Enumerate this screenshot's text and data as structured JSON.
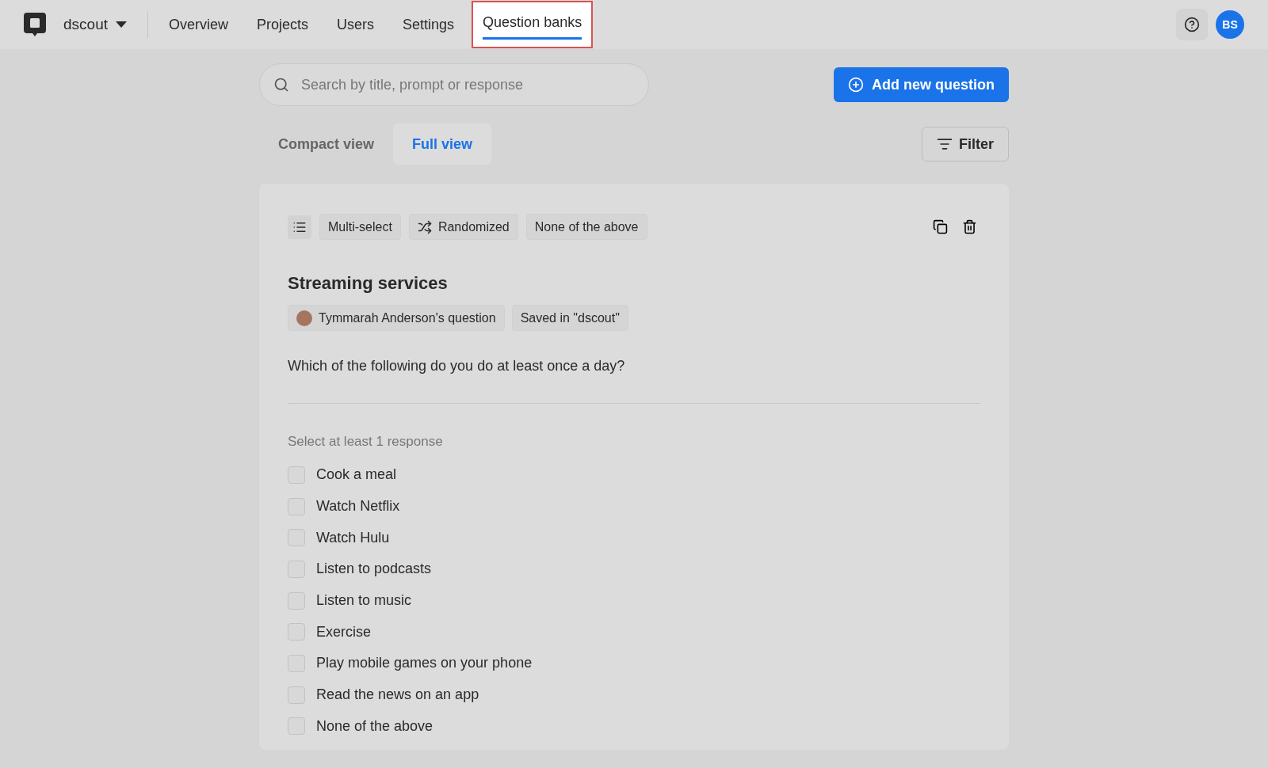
{
  "header": {
    "workspace": "dscout",
    "nav": [
      {
        "label": "Overview",
        "selected": false,
        "highlighted": false
      },
      {
        "label": "Projects",
        "selected": false,
        "highlighted": false
      },
      {
        "label": "Users",
        "selected": false,
        "highlighted": false
      },
      {
        "label": "Settings",
        "selected": false,
        "highlighted": false
      },
      {
        "label": "Question banks",
        "selected": true,
        "highlighted": true
      }
    ],
    "avatar": "BS"
  },
  "search": {
    "placeholder": "Search by title, prompt or response"
  },
  "add_button": "Add new question",
  "view_tabs": [
    {
      "label": "Compact view",
      "selected": false
    },
    {
      "label": "Full view",
      "selected": true
    }
  ],
  "filter_button": "Filter",
  "question": {
    "tags": [
      {
        "kind": "multi",
        "label": "Multi-select"
      },
      {
        "kind": "random",
        "label": "Randomized"
      },
      {
        "kind": "plain",
        "label": "None of the above"
      }
    ],
    "title": "Streaming services",
    "author": "Tymmarah Anderson's question",
    "saved_in": "Saved in \"dscout\"",
    "prompt": "Which of the following do you do at least once a day?",
    "instruction": "Select at least 1 response",
    "options": [
      {
        "label": "Cook a meal",
        "checked": false
      },
      {
        "label": "Watch Netflix",
        "checked": false
      },
      {
        "label": "Watch Hulu",
        "checked": false
      },
      {
        "label": "Listen to podcasts",
        "checked": false
      },
      {
        "label": "Listen to music",
        "checked": false
      },
      {
        "label": "Exercise",
        "checked": false
      },
      {
        "label": "Play mobile games on your phone",
        "checked": false
      },
      {
        "label": "Read the news on an app",
        "checked": false
      },
      {
        "label": "None of the above",
        "checked": false
      }
    ]
  }
}
